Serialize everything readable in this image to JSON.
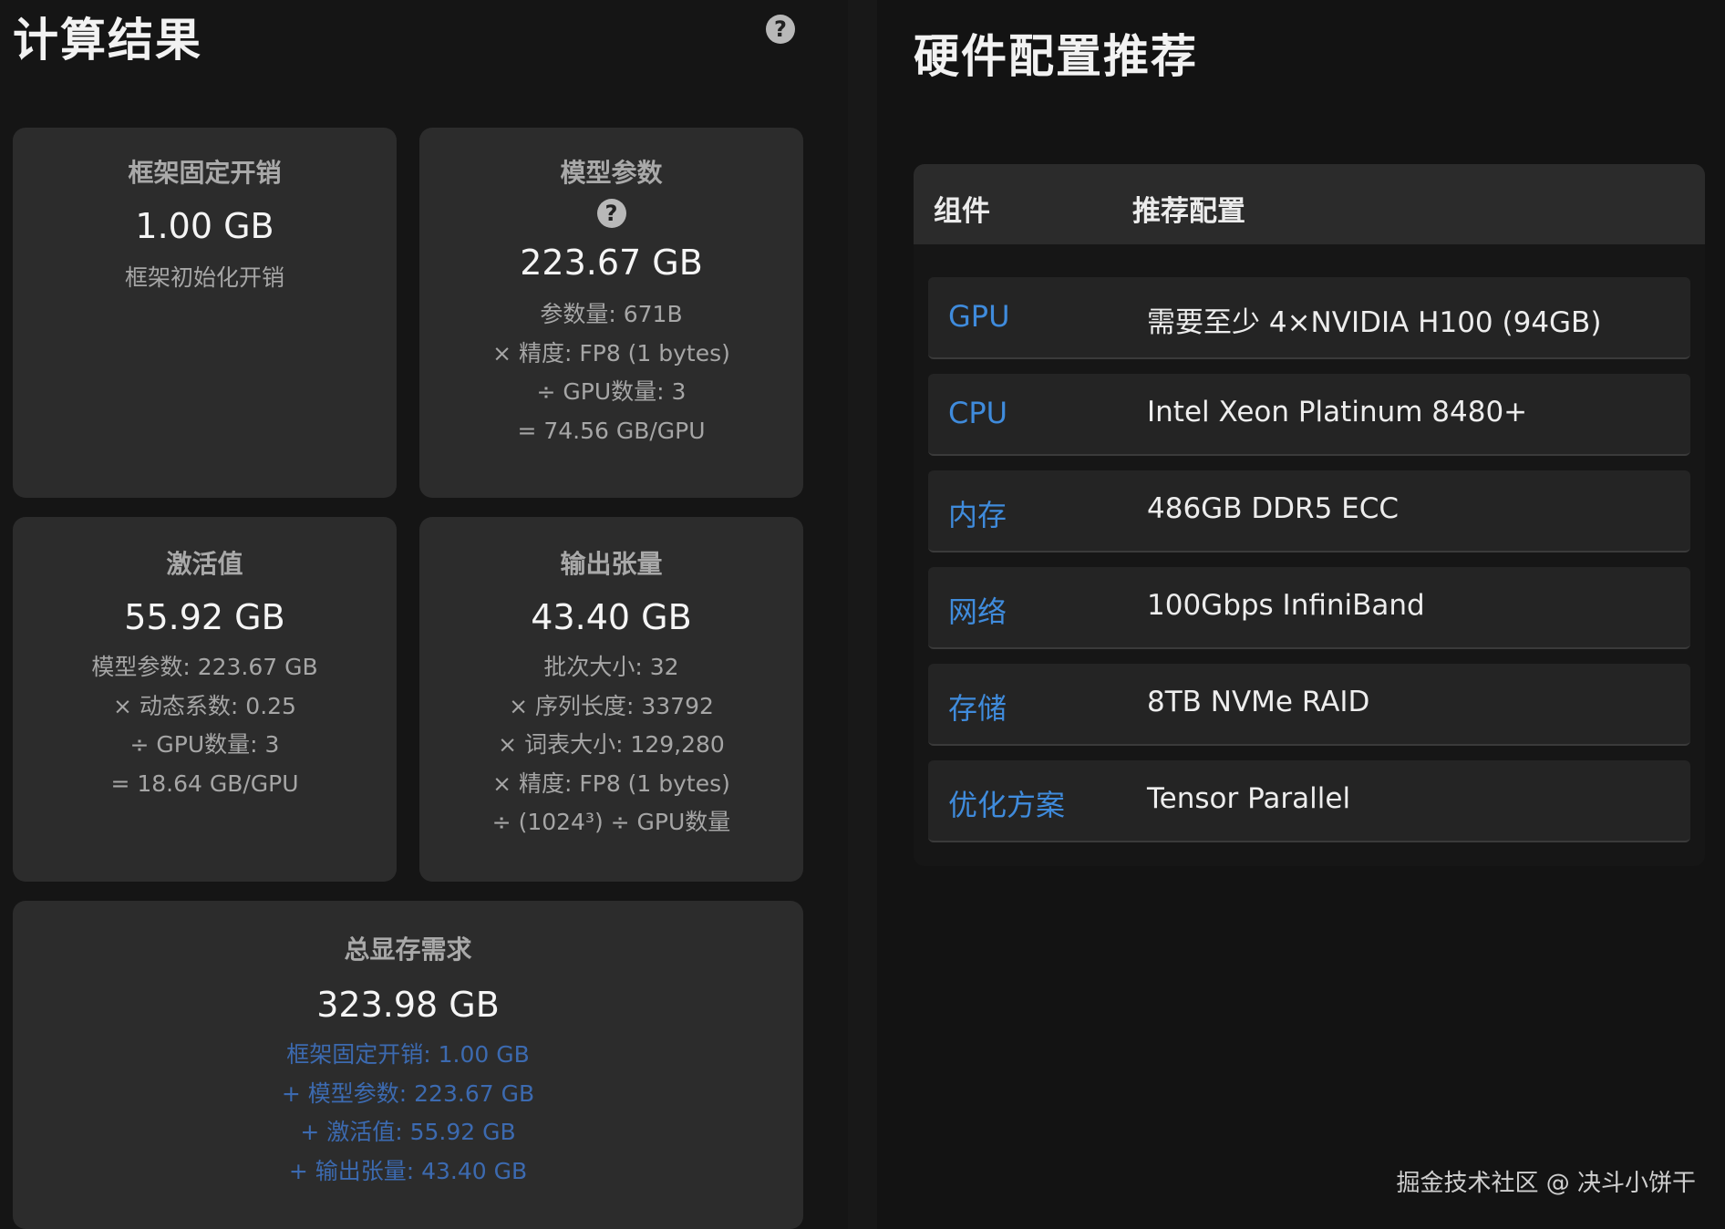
{
  "left": {
    "title": "计算结果",
    "help_glyph": "?",
    "cards": {
      "framework": {
        "label": "框架固定开销",
        "value": "1.00 GB",
        "lines": [
          "框架初始化开销"
        ]
      },
      "params": {
        "label": "模型参数",
        "value": "223.67 GB",
        "lines": [
          "参数量: 671B",
          "× 精度: FP8 (1 bytes)",
          "÷ GPU数量: 3",
          "= 74.56 GB/GPU"
        ]
      },
      "activation": {
        "label": "激活值",
        "value": "55.92 GB",
        "lines": [
          "模型参数: 223.67 GB",
          "× 动态系数: 0.25",
          "÷ GPU数量: 3",
          "= 18.64 GB/GPU"
        ]
      },
      "output": {
        "label": "输出张量",
        "value": "43.40 GB",
        "lines": [
          "批次大小: 32",
          "× 序列长度: 33792",
          "× 词表大小: 129,280",
          "× 精度: FP8 (1 bytes)",
          "÷ (1024³) ÷ GPU数量"
        ]
      },
      "total": {
        "label": "总显存需求",
        "value": "323.98 GB",
        "lines": [
          "框架固定开销: 1.00 GB",
          "+ 模型参数: 223.67 GB",
          "+ 激活值: 55.92 GB",
          "+ 输出张量: 43.40 GB"
        ]
      }
    }
  },
  "right": {
    "title": "硬件配置推荐",
    "table": {
      "headers": [
        "组件",
        "推荐配置"
      ],
      "rows": [
        {
          "component": "GPU",
          "config": "需要至少 4×NVIDIA H100 (94GB)"
        },
        {
          "component": "CPU",
          "config": "Intel Xeon Platinum 8480+"
        },
        {
          "component": "内存",
          "config": "486GB DDR5 ECC"
        },
        {
          "component": "网络",
          "config": "100Gbps InfiniBand"
        },
        {
          "component": "存储",
          "config": "8TB NVMe RAID"
        },
        {
          "component": "优化方案",
          "config": "Tensor Parallel"
        }
      ]
    }
  },
  "watermark": "掘金技术社区 @ 决斗小饼干",
  "colors": {
    "background": "#131313",
    "card": "#2c2c2c",
    "accent_blue": "#3f8bdc",
    "total_breakdown_blue": "#3c6ab0"
  }
}
